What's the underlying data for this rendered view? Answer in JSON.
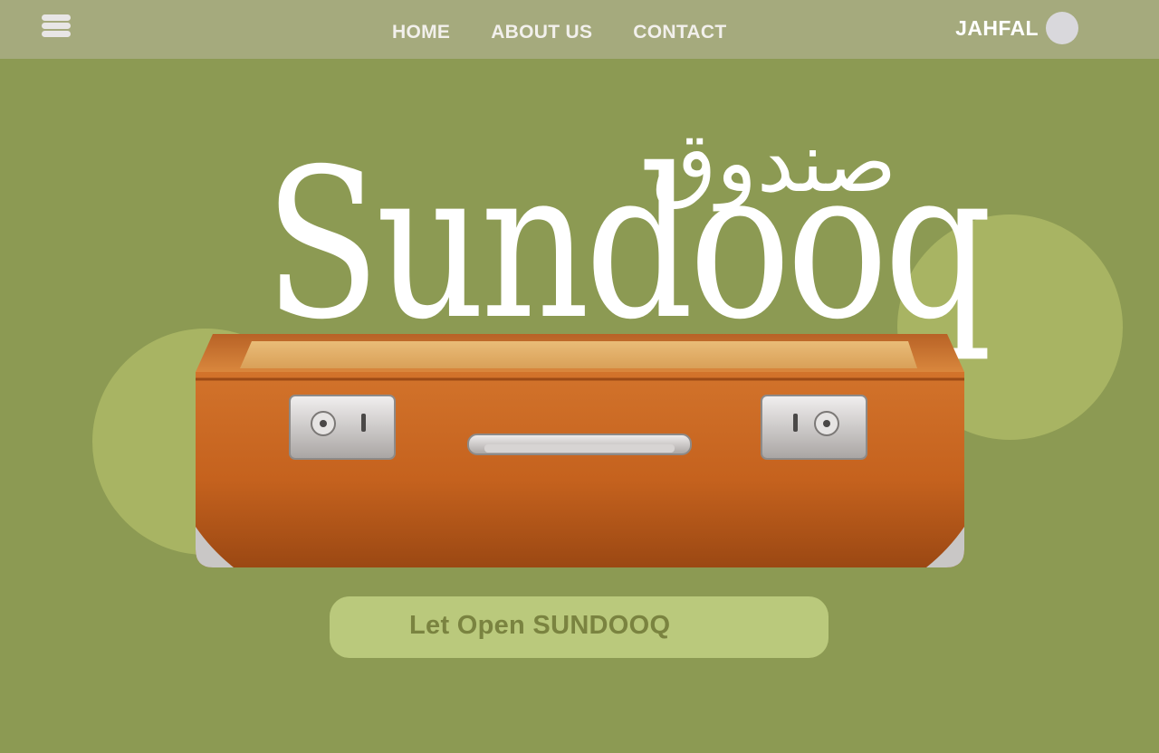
{
  "header": {
    "menu_icon": "hamburger-menu-icon",
    "nav": [
      {
        "label": "HOME"
      },
      {
        "label": "ABOUT US"
      },
      {
        "label": "CONTACT"
      }
    ],
    "user": {
      "name": "JAHFAL",
      "avatar": "avatar-circle"
    }
  },
  "hero": {
    "logo_text_latin": "Sundooq",
    "logo_text_arabic": "صندوق",
    "image": "suitcase-illustration"
  },
  "cta": {
    "label": "Let Open SUNDOOQ"
  },
  "colors": {
    "background": "#8c9a53",
    "header": "#a5aa7d",
    "circle": "#a8b463",
    "cta_background": "#bac97c",
    "cta_text": "#7a8340",
    "suitcase_body": "#c7621f"
  }
}
